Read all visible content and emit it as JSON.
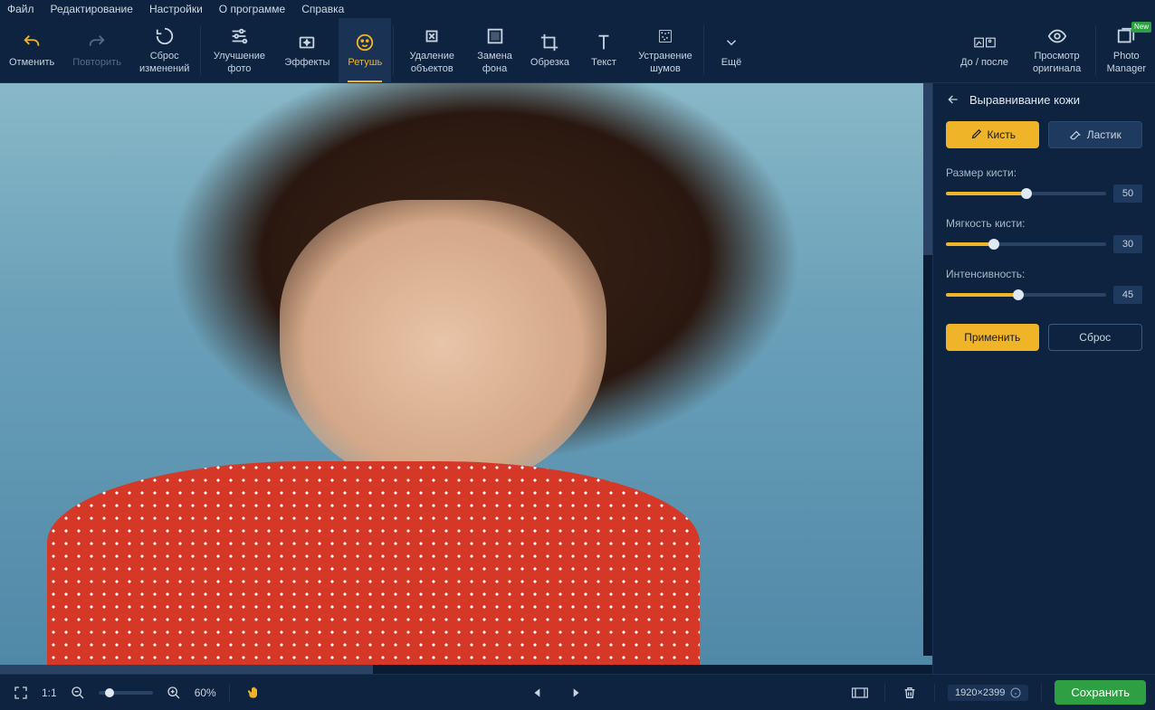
{
  "menubar": {
    "file": "Файл",
    "edit": "Редактирование",
    "settings": "Настройки",
    "about": "О программе",
    "help": "Справка"
  },
  "toolbar": {
    "undo": "Отменить",
    "redo": "Повторить",
    "reset": "Сброс\nизменений",
    "enhance": "Улучшение\nфото",
    "effects": "Эффекты",
    "retouch": "Ретушь",
    "remove_obj": "Удаление\nобъектов",
    "bg_replace": "Замена\nфона",
    "crop": "Обрезка",
    "text": "Текст",
    "denoise": "Устранение\nшумов",
    "more": "Ещё",
    "before_after": "До / после",
    "view_original": "Просмотр\nоригинала",
    "photo_manager": "Photo\nManager",
    "new_badge": "New"
  },
  "panel": {
    "title": "Выравнивание кожи",
    "brush": "Кисть",
    "eraser": "Ластик",
    "brush_size_label": "Размер кисти:",
    "brush_size_value": "50",
    "softness_label": "Мягкость кисти:",
    "softness_value": "30",
    "intensity_label": "Интенсивность:",
    "intensity_value": "45",
    "apply": "Применить",
    "reset": "Сброс"
  },
  "bottombar": {
    "fit_label": "1:1",
    "zoom_pct": "60%",
    "dimensions": "1920×2399",
    "save": "Сохранить"
  }
}
